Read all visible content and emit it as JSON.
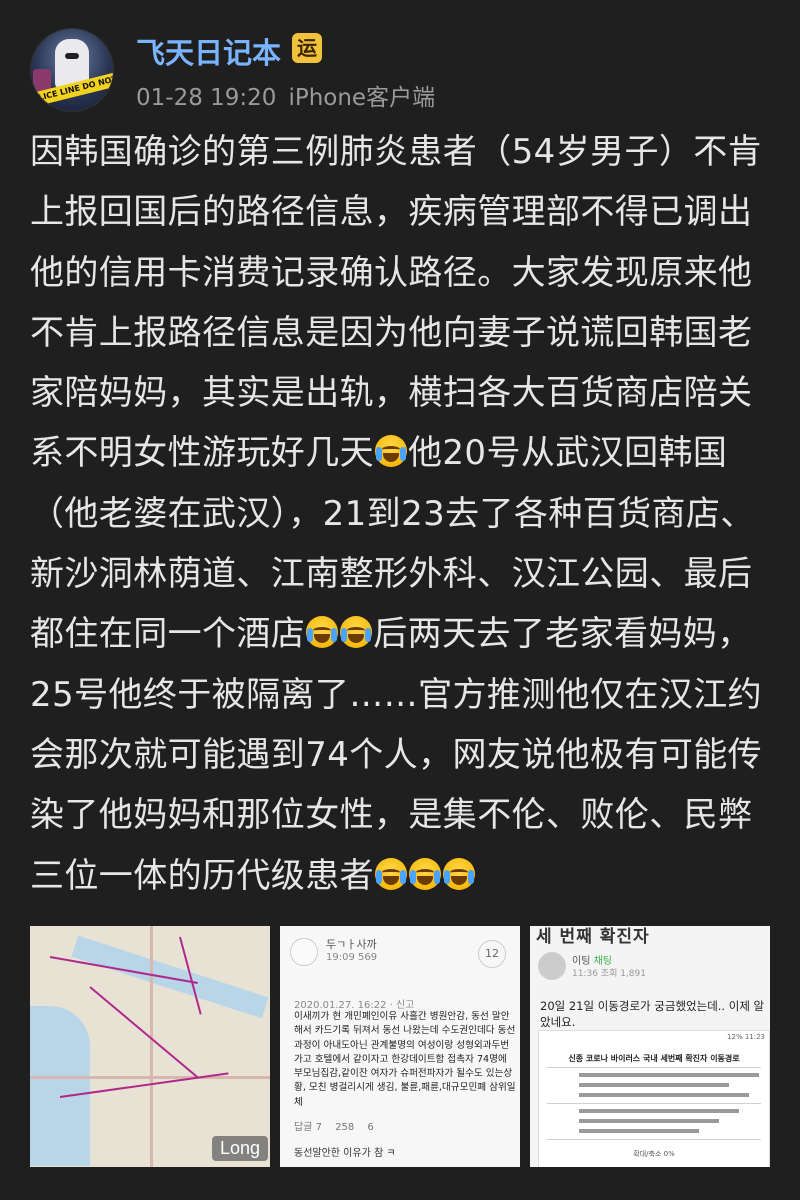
{
  "post": {
    "author": "飞天日记本",
    "author_badge": "运",
    "time": "01-28 19:20",
    "source": "iPhone客户端",
    "lines": [
      "因韩国确诊的第三例肺炎患者（54岁男子）不肯",
      "上报回国后的路径信息，疾病管理部不得已调出",
      "他的信用卡消费记录确认路径。大家发现原来他",
      "不肯上报路径信息是因为他向妻子说谎回韩国老",
      "家陪妈妈，其实是出轨，横扫各大百货商店陪关",
      [
        "系不明女性游玩好几天",
        "他20号从武汉回韩国"
      ],
      "（他老婆在武汉），21到23去了各种百货商店、",
      "新沙洞林荫道、江南整形外科、汉江公园、最后",
      [
        "都住在同一个酒店",
        "后两天去了老家看妈妈，"
      ],
      "25号他终于被隔离了……官方推测他仅在汉江约",
      "会那次就可能遇到74个人，网友说他极有可能传",
      "染了他妈妈和那位女性，是集不伦、败伦、民弊",
      "三位一体的历代级患者"
    ]
  },
  "images": {
    "map": {
      "long_label": "Long",
      "avatar_tape": "POLICE LINE DO NOT CROSS"
    },
    "korean_post": {
      "name": "두ㄱㅏ사까",
      "stats": "19:09  569",
      "comment_count": "12",
      "date": "2020.01.27. 16:22 · 신고",
      "body": "이새끼가 현 개민폐인이유 사흘간 병원안감, 동선 말안해서 카드기록 뒤져서 동선 나왔는데 수도권인데다 동선과정이 아내도아닌 관계불명의 여성이랑 성형외과두번가고 호텔에서 같이자고 한강데이트함 접촉자 74명에 부모님집감,같이잔 여자가 슈퍼전파자가 될수도 있는상황, 모친 병걸리시게 생김, 불륜,패륜,대규모민폐 삼위일체",
      "reply_label": "답글 7",
      "likes": "258",
      "dislikes": "6",
      "reply_text": "동선말안한 이유가 참 ㅋ"
    },
    "confirmed_case": {
      "title": "세 번째 확진자",
      "user": "이팅",
      "tag": "채팅",
      "time": "11:36 조회 1,891",
      "text": "20일 21일 이동경로가 궁금했었는데.. 이제 알았네요.",
      "phone_status": "12% 11:23",
      "table_title": "신종 코로나 바이러스 국내 세번째 확진자 이동경로",
      "table_foot": "확대/축소 0%"
    }
  }
}
